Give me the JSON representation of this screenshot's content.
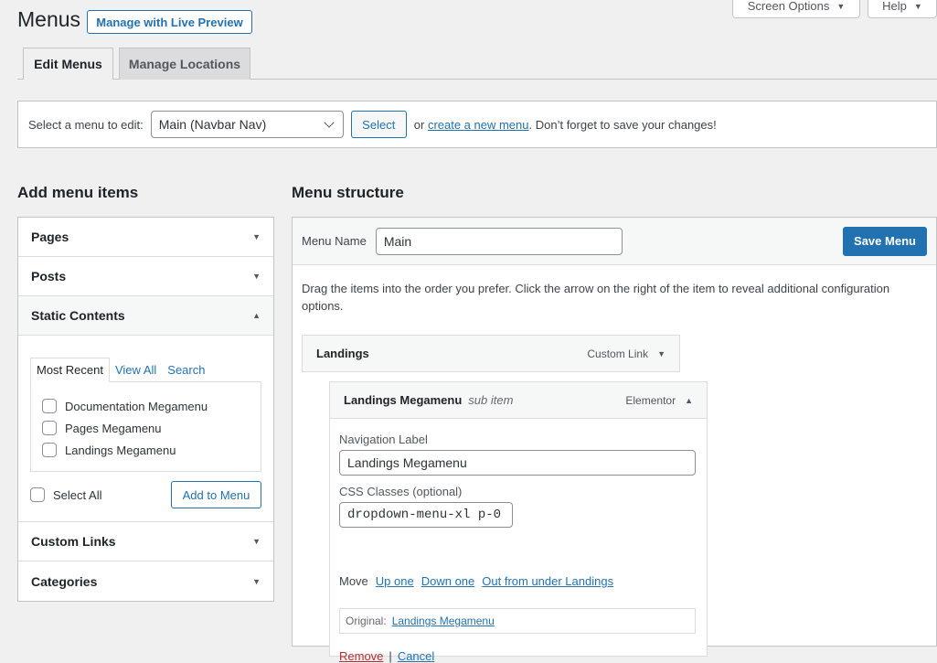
{
  "header": {
    "title": "Menus",
    "live_preview_label": "Manage with Live Preview",
    "screen_options_label": "Screen Options",
    "help_label": "Help"
  },
  "tabs": [
    {
      "label": "Edit Menus",
      "active": true
    },
    {
      "label": "Manage Locations",
      "active": false
    }
  ],
  "manage": {
    "select_label": "Select a menu to edit:",
    "selected_menu": "Main (Navbar Nav)",
    "select_button": "Select",
    "or_text": "or",
    "create_link": "create a new menu",
    "reminder": ". Don’t forget to save your changes!"
  },
  "add_items": {
    "heading": "Add menu items",
    "sections": [
      {
        "label": "Pages",
        "open": false
      },
      {
        "label": "Posts",
        "open": false
      },
      {
        "label": "Static Contents",
        "open": true
      },
      {
        "label": "Custom Links",
        "open": false
      },
      {
        "label": "Categories",
        "open": false
      }
    ],
    "static_tabs": [
      "Most Recent",
      "View All",
      "Search"
    ],
    "static_items": [
      "Documentation Megamenu",
      "Pages Megamenu",
      "Landings Megamenu"
    ],
    "select_all_label": "Select All",
    "add_button": "Add to Menu"
  },
  "structure": {
    "heading": "Menu structure",
    "menu_name_label": "Menu Name",
    "menu_name_value": "Main",
    "save_button": "Save Menu",
    "instructions": "Drag the items into the order you prefer. Click the arrow on the right of the item to reveal additional configuration options.",
    "items": [
      {
        "title": "Landings",
        "sub": "",
        "type": "Custom Link"
      },
      {
        "title": "Landings Megamenu",
        "sub": "sub item",
        "type": "Elementor"
      }
    ],
    "settings": {
      "nav_label_title": "Navigation Label",
      "nav_label_value": "Landings Megamenu",
      "css_title": "CSS Classes (optional)",
      "css_value": "dropdown-menu-xl p-0",
      "move_label": "Move",
      "move_links": [
        "Up one",
        "Down one",
        "Out from under Landings"
      ],
      "original_label": "Original:",
      "original_link": "Landings Megamenu",
      "remove_label": "Remove",
      "separator": "|",
      "cancel_label": "Cancel"
    }
  }
}
